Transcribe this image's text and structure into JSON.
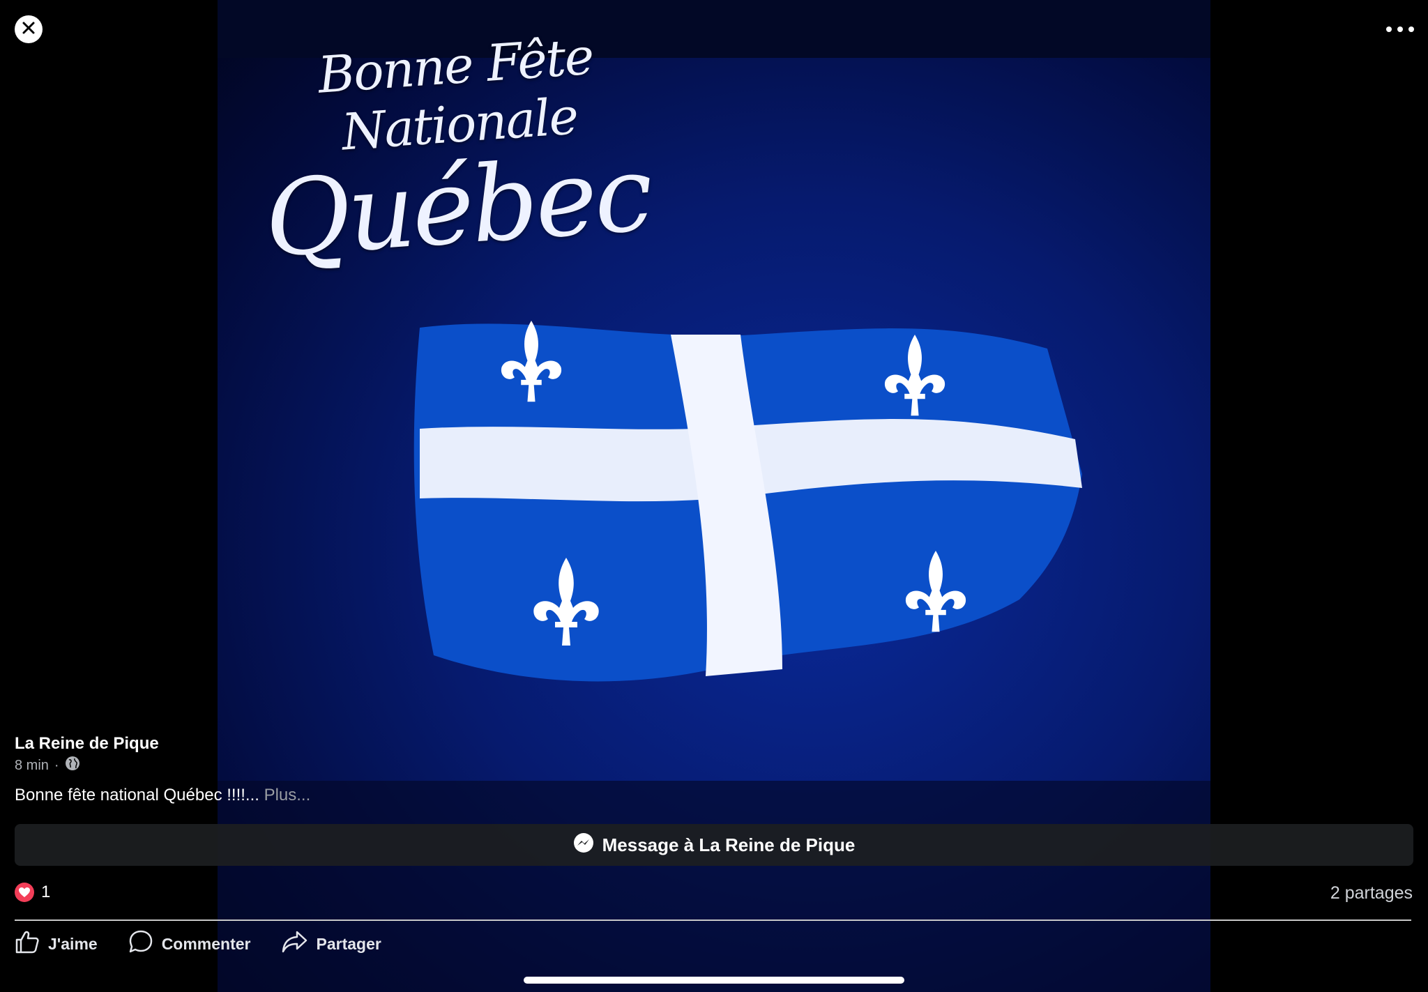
{
  "photo": {
    "title_line1": "Bonne Fête Nationale",
    "title_line2": "Québec"
  },
  "post": {
    "author": "La Reine de Pique",
    "time": "8 min",
    "separator": "·",
    "privacy_icon": "globe-icon",
    "caption": "Bonne fête national Québec !!!!...",
    "more_link": "Plus...",
    "message_button": "Message à La Reine de Pique",
    "reaction_count": "1",
    "shares": "2 partages"
  },
  "actions": {
    "like": "J'aime",
    "comment": "Commenter",
    "share": "Partager"
  },
  "icons": {
    "close": "close-icon",
    "more": "more-options-icon",
    "messenger": "messenger-icon",
    "heart": "heart-icon",
    "like": "thumbs-up-icon",
    "comment": "comment-icon",
    "share": "share-icon"
  },
  "colors": {
    "flag_blue": "#0b4fc9",
    "heart": "#f33e58",
    "background": "#000000"
  }
}
